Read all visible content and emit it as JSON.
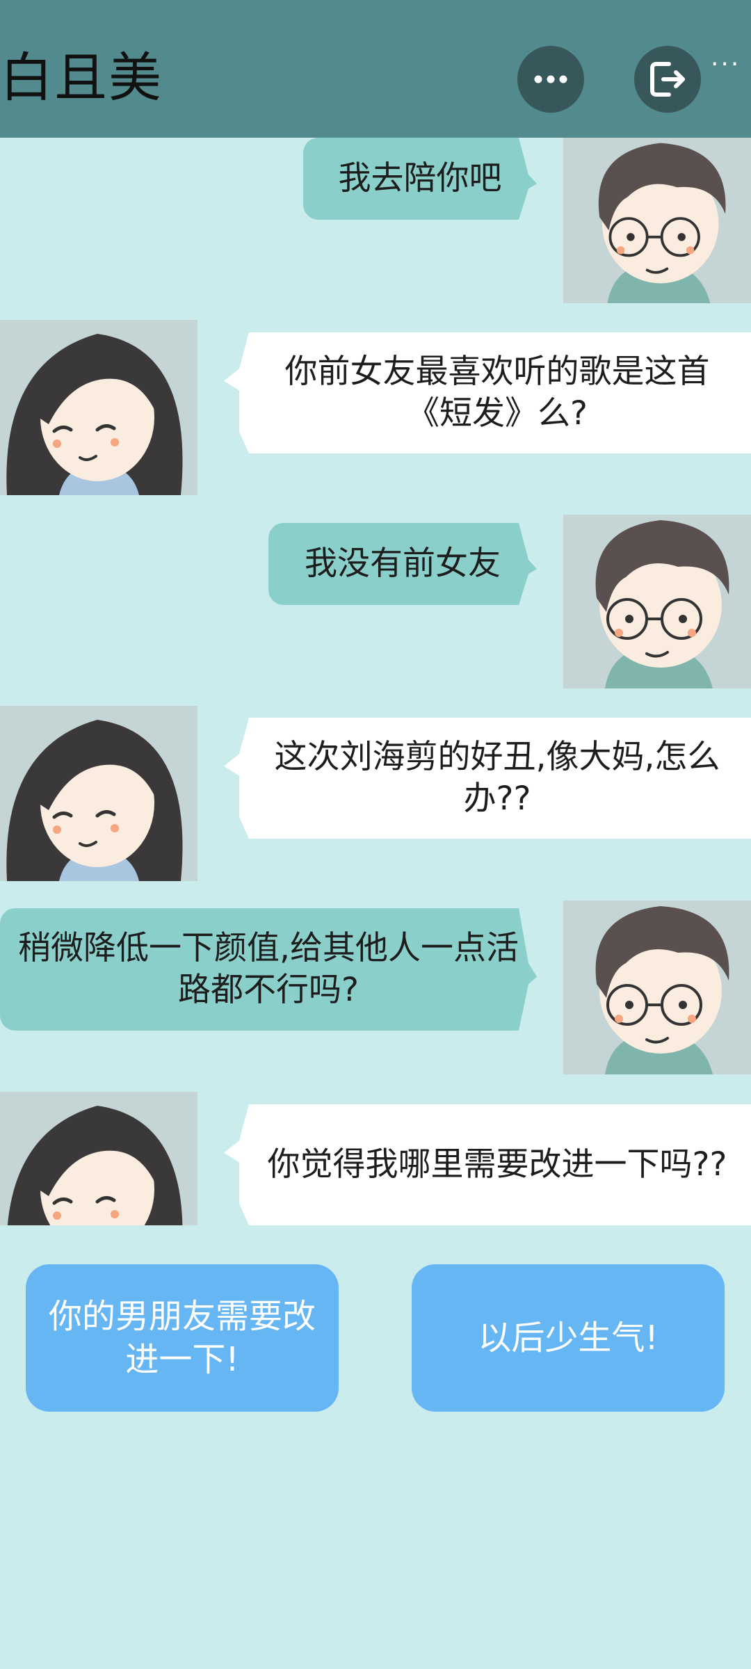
{
  "header": {
    "title": "白且美",
    "more_icon": "more-horizontal-icon",
    "exit_icon": "exit-icon",
    "corner_dots": "···"
  },
  "messages": [
    {
      "speaker": "boy",
      "text": "我去陪你吧"
    },
    {
      "speaker": "girl",
      "text": "你前女友最喜欢听的歌是这首《短发》么?"
    },
    {
      "speaker": "boy",
      "text": "我没有前女友"
    },
    {
      "speaker": "girl",
      "text": "这次刘海剪的好丑,像大妈,怎么办??"
    },
    {
      "speaker": "boy",
      "text": "稍微降低一下颜值,给其他人一点活路都不行吗?"
    },
    {
      "speaker": "girl",
      "text": "你觉得我哪里需要改进一下吗??"
    }
  ],
  "choices": [
    {
      "label": "你的男朋友需要改进一下!"
    },
    {
      "label": "以后少生气!"
    }
  ],
  "colors": {
    "background": "#cbeced",
    "header": "#528a8e",
    "boy_bubble": "#8bcfca",
    "girl_bubble": "#ffffff",
    "choice": "#66b6f4"
  }
}
